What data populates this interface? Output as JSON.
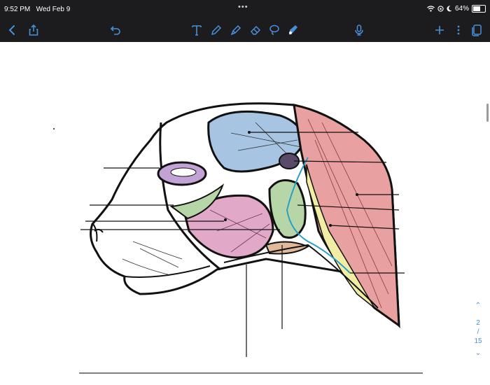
{
  "status": {
    "time": "9:52 PM",
    "date": "Wed Feb 9",
    "battery": "64%",
    "battery_level": 0.64
  },
  "toolbar": {
    "left": [
      "back-icon",
      "share-icon"
    ],
    "undo": "undo-icon",
    "tools": [
      "text-tool-icon",
      "pen-tool-icon",
      "highlighter-tool-icon",
      "eraser-tool-icon",
      "lasso-tool-icon",
      "color-picker-icon"
    ],
    "right": [
      "microphone-icon",
      "add-icon",
      "more-icon",
      "pages-icon"
    ],
    "accent": "#4a90d9"
  },
  "pager": {
    "current": "2",
    "separator": "/",
    "total": "15"
  },
  "diagram": {
    "colors": {
      "outline": "#111111",
      "blue_region": "#a8c4e3",
      "red_region": "#e8a0a0",
      "pink_region": "#e2a8c8",
      "green_region": "#b6d6a8",
      "yellow_region": "#f2eda4",
      "purple_region": "#c3a3d6",
      "duct": "#2a9fc4",
      "orange_region": "#e0b89a"
    }
  }
}
